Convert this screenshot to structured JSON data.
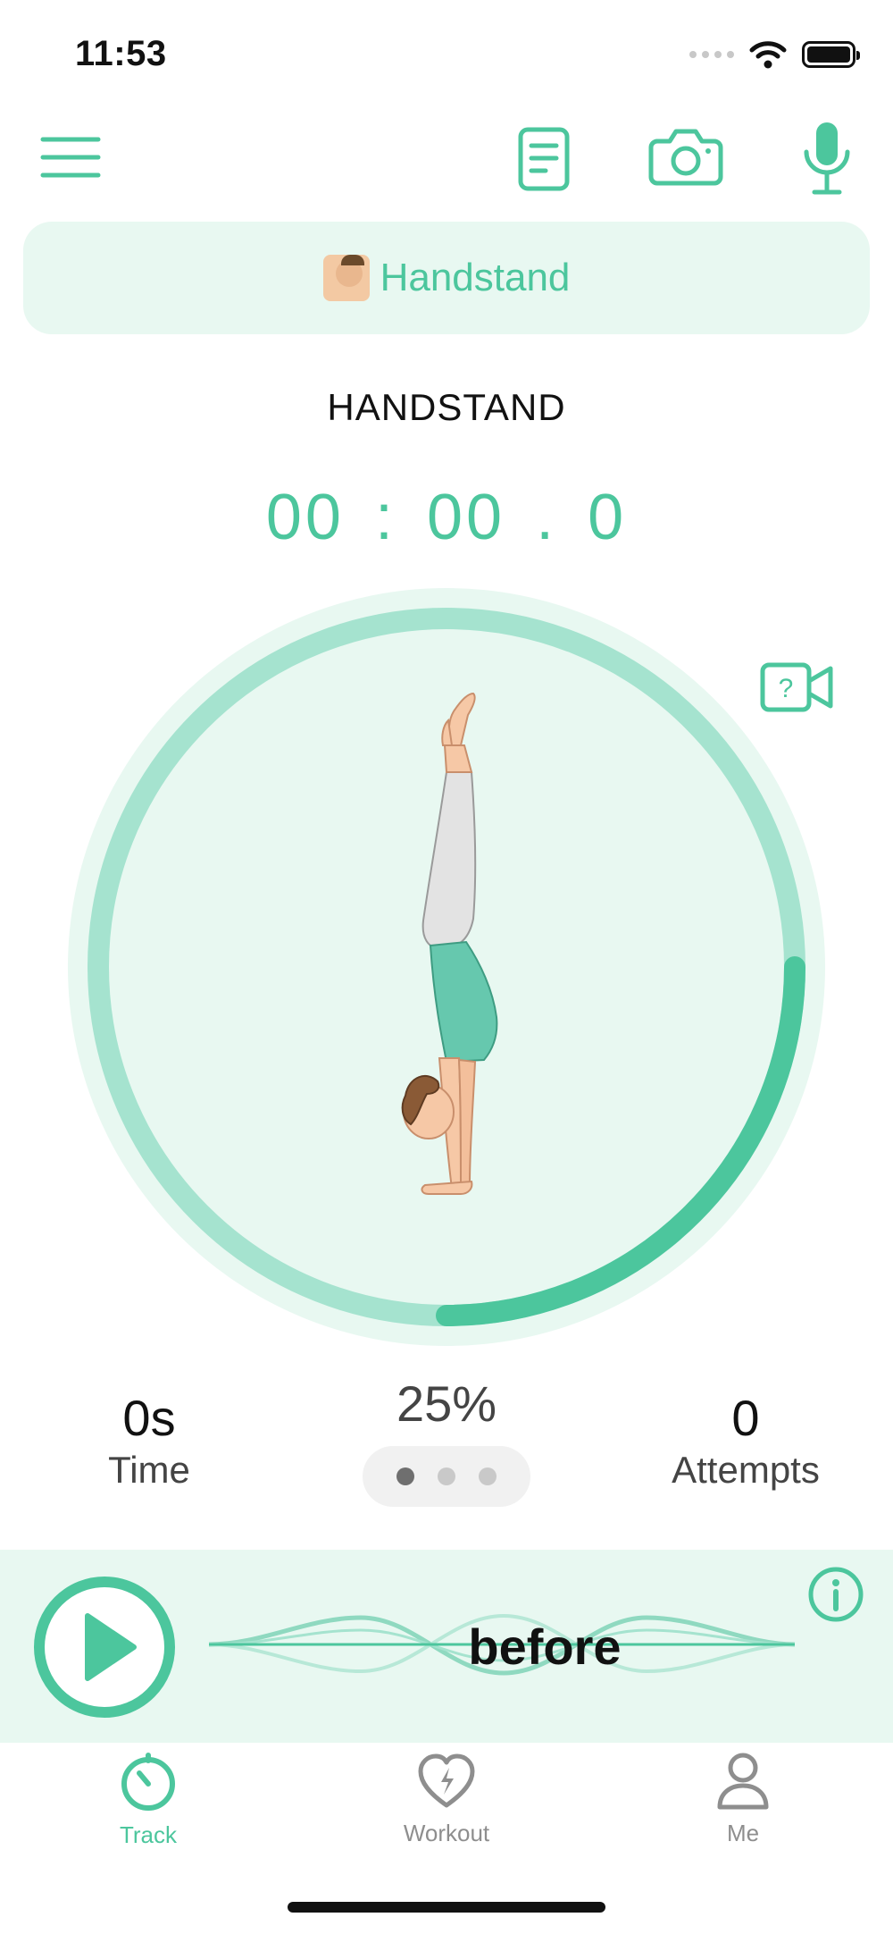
{
  "status_bar": {
    "time": "11:53"
  },
  "selector": {
    "label": "Handstand"
  },
  "exercise": {
    "name": "HANDSTAND",
    "timer": "00 : 00 . 0"
  },
  "ring": {
    "progress_fraction": 0.25
  },
  "stats": {
    "time_value": "0s",
    "time_label": "Time",
    "progress": "25%",
    "attempts_value": "0",
    "attempts_label": "Attempts",
    "pager_active_index": 0,
    "pager_count": 3
  },
  "player": {
    "cue_word": "before"
  },
  "tabs": [
    {
      "label": "Track",
      "active": true
    },
    {
      "label": "Workout",
      "active": false
    },
    {
      "label": "Me",
      "active": false
    }
  ],
  "colors": {
    "accent": "#4cc69d",
    "accent_light": "#e8f8f1",
    "ring_track": "#a5e3cf",
    "ring_outer": "#e8f8f1",
    "inactive": "#8e8e8e"
  },
  "icons": {
    "menu": "hamburger-icon",
    "notes": "document-icon",
    "camera": "camera-icon",
    "mic": "microphone-icon",
    "help_video": "video-help-icon",
    "play": "play-icon",
    "info": "info-icon",
    "track_tab": "stopwatch-icon",
    "workout_tab": "heart-bolt-icon",
    "me_tab": "person-icon"
  }
}
